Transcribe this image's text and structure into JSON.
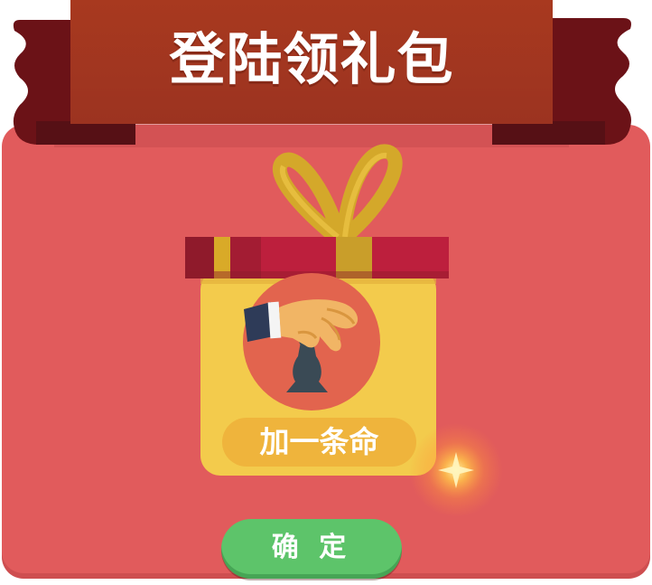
{
  "banner": {
    "title": "登陆领礼包"
  },
  "gift": {
    "icon": "gift-box-icon",
    "reward_icon": "hand-chess-piece-icon",
    "reward_label": "加一条命"
  },
  "confirm_button": {
    "label": "确 定"
  },
  "colors": {
    "card": "#e15b5c",
    "banner": "#a33720",
    "ribbon_tail": "#6b1217",
    "box_body": "#f3cb4c",
    "lid": "#bd1f3d",
    "bow": "#d4a82a",
    "reward_circle": "#e2644e",
    "reward_pill": "#efb43c",
    "confirm": "#5dc46a"
  }
}
